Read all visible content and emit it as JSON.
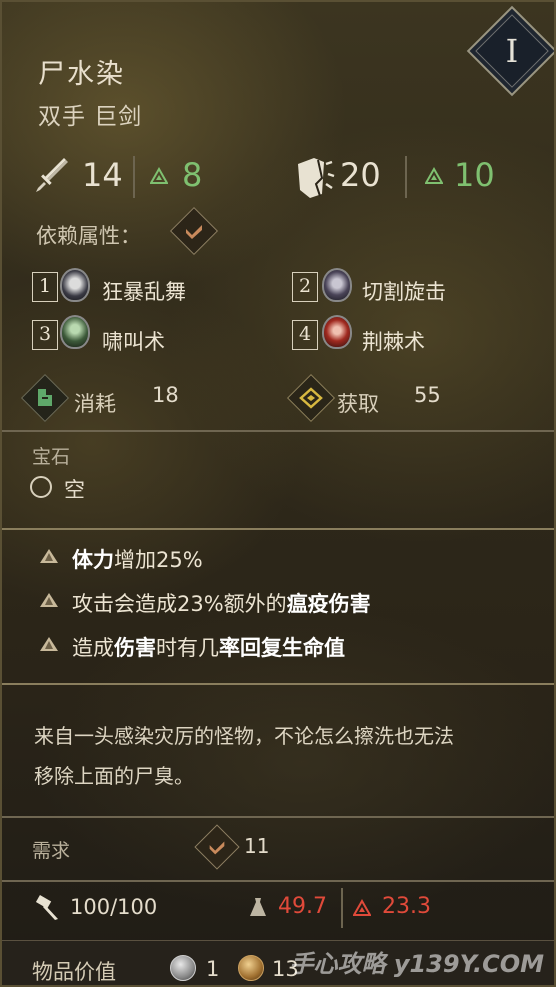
{
  "item": {
    "name": "尸水染",
    "type": "双手 巨剑",
    "tier": "I"
  },
  "stats": {
    "damage": "14",
    "damage_upgrade": "8",
    "stagger": "20",
    "stagger_upgrade": "10"
  },
  "dependency": {
    "label": "依赖属性："
  },
  "skills": [
    {
      "num": "1",
      "name": "狂暴乱舞"
    },
    {
      "num": "2",
      "name": "切割旋击"
    },
    {
      "num": "3",
      "name": "啸叫术"
    },
    {
      "num": "4",
      "name": "荆棘术"
    }
  ],
  "resources": {
    "consume_label": "消耗",
    "consume_value": "18",
    "gain_label": "获取",
    "gain_value": "55"
  },
  "gem": {
    "label": "宝石",
    "slot": "空"
  },
  "effects": [
    {
      "pre": "",
      "bold1": "体力",
      "mid": "增加25%",
      "bold2": "",
      "post": ""
    },
    {
      "pre": "攻击会造成23%额外的",
      "bold1": "瘟疫伤害",
      "mid": "",
      "bold2": "",
      "post": ""
    },
    {
      "pre": "造成",
      "bold1": "伤害",
      "mid": "时有几",
      "bold2": "率回复生命值",
      "post": ""
    }
  ],
  "flavor": {
    "line1": "来自一头感染灾厉的怪物，不论怎么擦洗也无法",
    "line2": "移除上面的尸臭。"
  },
  "requirement": {
    "label": "需求",
    "value": "11"
  },
  "durability": {
    "value": "100/100",
    "weight": "49.7",
    "threat": "23.3"
  },
  "value": {
    "label": "物品价值",
    "silver": "1",
    "gold": "13"
  },
  "watermark": "手心攻略 y139Y.COM",
  "colors": {
    "upgrade_green": "#7fc070",
    "warning_red": "#e04a3a",
    "dependency_icon": "#c98a5c",
    "gain_icon": "#d8b840",
    "consume_icon": "#5fa86a"
  }
}
